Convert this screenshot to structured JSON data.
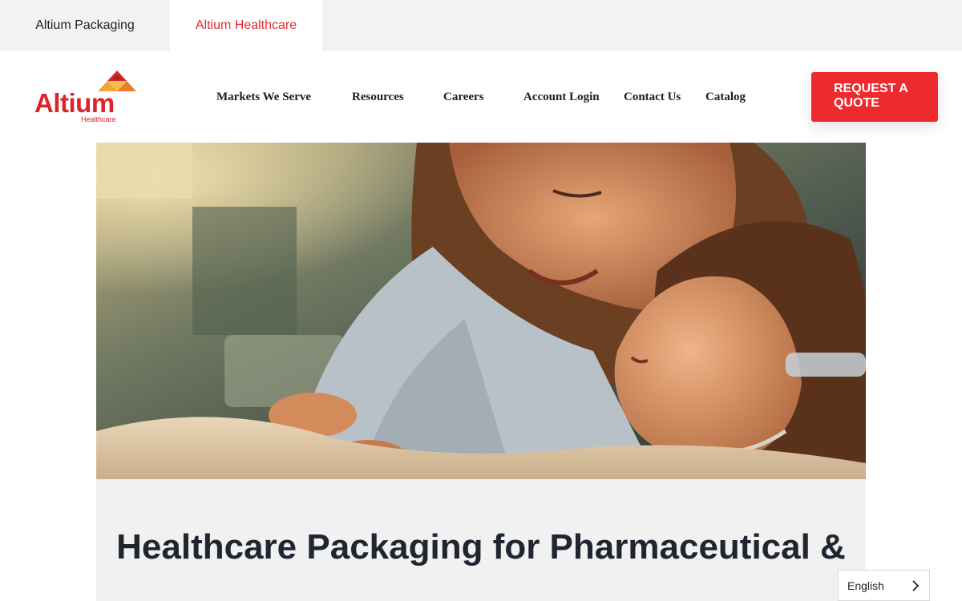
{
  "site_tabs": [
    {
      "label": "Altium Packaging",
      "active": false
    },
    {
      "label": "Altium Healthcare",
      "active": true
    }
  ],
  "logo": {
    "name": "Altium",
    "sub": "Healthcare"
  },
  "nav": {
    "items": [
      {
        "label": "Markets We Serve"
      },
      {
        "label": "Resources"
      },
      {
        "label": "Careers"
      },
      {
        "label": "Account Login"
      },
      {
        "label": "Contact Us"
      },
      {
        "label": "Catalog"
      }
    ]
  },
  "quote_button": {
    "label": "REQUEST A QUOTE"
  },
  "hero": {
    "icon": "hero-photo"
  },
  "content": {
    "headline": "Healthcare Packaging for Pharmaceutical &"
  },
  "language": {
    "selected": "English"
  },
  "colors": {
    "brand_red": "#ee2a2e",
    "logo_red": "#d8262c",
    "tab_bar": "#f1f2f3",
    "content_bg": "#f1f1f2"
  }
}
